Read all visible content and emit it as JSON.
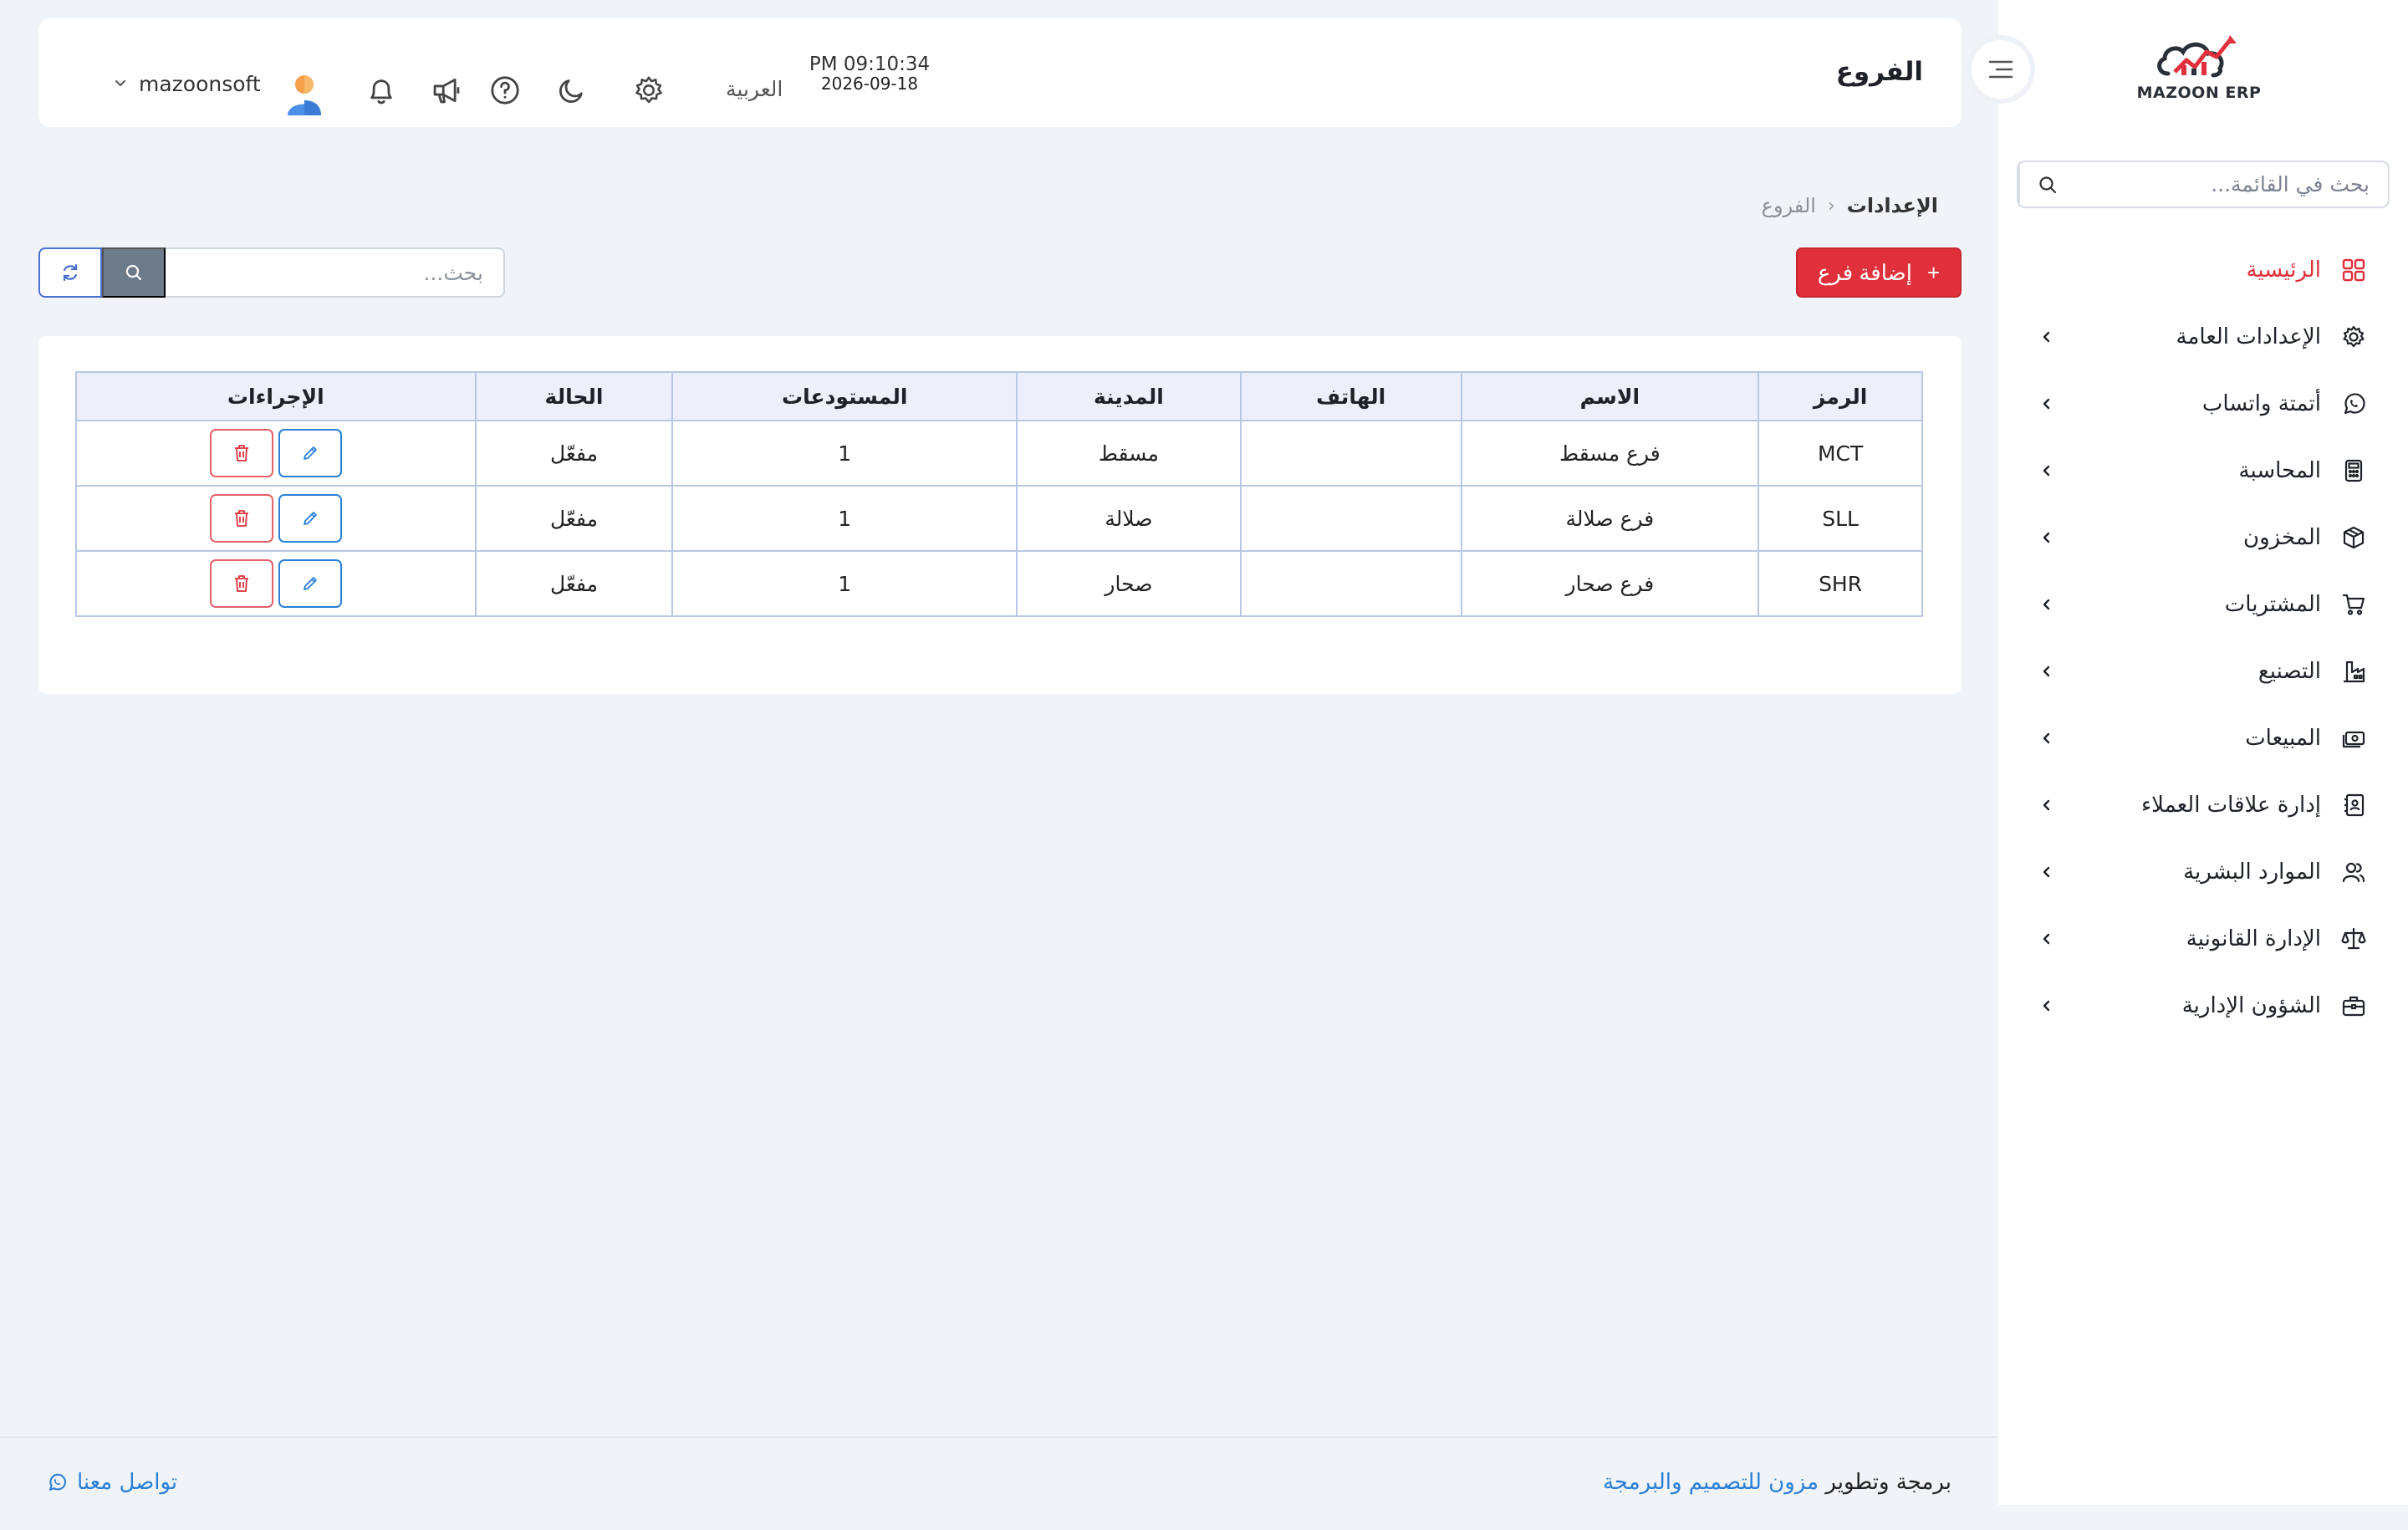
{
  "brand": {
    "name": "MAZOON ERP",
    "colors": {
      "accent": "#e0303c",
      "link": "#2a7fd6",
      "primary_border": "#4a6fd1"
    }
  },
  "sidebar": {
    "search_placeholder": "بحث في القائمة...",
    "items": [
      {
        "label": "الرئيسية",
        "icon": "grid-icon",
        "active": true
      },
      {
        "label": "الإعدادات العامة",
        "icon": "gear-icon"
      },
      {
        "label": "أتمتة واتساب",
        "icon": "whatsapp-icon"
      },
      {
        "label": "المحاسبة",
        "icon": "calculator-icon"
      },
      {
        "label": "المخزون",
        "icon": "box-icon"
      },
      {
        "label": "المشتريات",
        "icon": "cart-icon"
      },
      {
        "label": "التصنيع",
        "icon": "factory-icon"
      },
      {
        "label": "المبيعات",
        "icon": "cash-icon"
      },
      {
        "label": "إدارة علاقات العملاء",
        "icon": "contacts-icon"
      },
      {
        "label": "الموارد البشرية",
        "icon": "users-icon"
      },
      {
        "label": "الإدارة القانونية",
        "icon": "scales-icon"
      },
      {
        "label": "الشؤون الإدارية",
        "icon": "briefcase-icon"
      }
    ]
  },
  "header": {
    "title": "الفروع",
    "time": "PM 09:10:34",
    "date": "2026-09-18",
    "language": "العربية",
    "username": "mazoonsoft"
  },
  "breadcrumb": {
    "parent": "الإعدادات",
    "current": "الفروع"
  },
  "toolbar": {
    "add_label": "إضافة فرع",
    "search_placeholder": "بحث..."
  },
  "table": {
    "columns": [
      "الرمز",
      "الاسم",
      "الهاتف",
      "المدينة",
      "المستودعات",
      "الحالة",
      "الإجراءات"
    ],
    "rows": [
      {
        "code": "MCT",
        "name": "فرع مسقط",
        "phone": "",
        "city": "مسقط",
        "warehouses": "1",
        "status": "مفعّل"
      },
      {
        "code": "SLL",
        "name": "فرع صلالة",
        "phone": "",
        "city": "صلالة",
        "warehouses": "1",
        "status": "مفعّل"
      },
      {
        "code": "SHR",
        "name": "فرع صحار",
        "phone": "",
        "city": "صحار",
        "warehouses": "1",
        "status": "مفعّل"
      }
    ]
  },
  "footer": {
    "credit_prefix": "برمجة وتطوير",
    "credit_link": "مزون للتصميم والبرمجة",
    "contact": "تواصل معنا"
  }
}
